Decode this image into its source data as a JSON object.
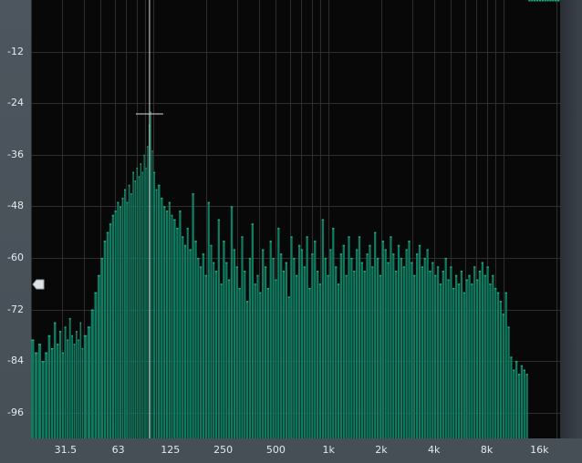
{
  "app": {
    "name": "spectrum-analyzer"
  },
  "y_axis": {
    "labels": [
      "-12",
      "-24",
      "-36",
      "-48",
      "-60",
      "-72",
      "-84",
      "-96"
    ],
    "values": [
      -12,
      -24,
      -36,
      -48,
      -60,
      -72,
      -84,
      -96
    ],
    "range": [
      -102,
      0
    ]
  },
  "x_axis": {
    "labels": [
      "31.5",
      "63",
      "125",
      "250",
      "500",
      "1k",
      "2k",
      "4k",
      "8k",
      "16k"
    ],
    "values": [
      31.5,
      63,
      125,
      250,
      500,
      1000,
      2000,
      4000,
      8000,
      16000
    ],
    "range": [
      20,
      21000
    ],
    "scale": "log"
  },
  "cursor": {
    "frequency": 95,
    "level": -26.5
  },
  "colors": {
    "bars": "#0f7b60",
    "bars_highlight": "#1fa882",
    "grid": "#2e2e2e",
    "background": "#080808",
    "cursor": "#d9d9d9"
  },
  "chart_data": {
    "type": "bar",
    "series_label": "",
    "x_scale": "log",
    "xlim": [
      20,
      21000
    ],
    "ylim": [
      -102,
      0
    ],
    "x": [
      20,
      21,
      22,
      23,
      24,
      25,
      26,
      27,
      28,
      29,
      30,
      31,
      32,
      33,
      34,
      35,
      36,
      37,
      38,
      39,
      40,
      42,
      44,
      46,
      48,
      50,
      52,
      54,
      56,
      58,
      60,
      62,
      64,
      66,
      68,
      70,
      72,
      74,
      76,
      78,
      80,
      82,
      84,
      86,
      88,
      90,
      92,
      94,
      96,
      98,
      100,
      103,
      106,
      110,
      114,
      118,
      122,
      126,
      130,
      135,
      140,
      145,
      150,
      155,
      160,
      166,
      172,
      178,
      184,
      190,
      197,
      204,
      211,
      218,
      225,
      233,
      241,
      249,
      258,
      267,
      276,
      286,
      296,
      306,
      317,
      328,
      339,
      351,
      363,
      376,
      389,
      402,
      416,
      431,
      446,
      461,
      477,
      494,
      511,
      529,
      547,
      566,
      586,
      606,
      627,
      649,
      672,
      695,
      719,
      744,
      770,
      797,
      825,
      854,
      884,
      915,
      947,
      980,
      1014,
      1049,
      1086,
      1124,
      1163,
      1204,
      1246,
      1290,
      1335,
      1382,
      1430,
      1480,
      1532,
      1585,
      1641,
      1698,
      1758,
      1819,
      1883,
      1949,
      2017,
      2088,
      2161,
      2237,
      2315,
      2396,
      2480,
      2567,
      2657,
      2750,
      2846,
      2946,
      3049,
      3156,
      3266,
      3381,
      3499,
      3622,
      3749,
      3880,
      4016,
      4157,
      4302,
      4453,
      4609,
      4770,
      4937,
      5110,
      5289,
      5474,
      5666,
      5864,
      6070,
      6282,
      6502,
      6730,
      6965,
      7209,
      7462,
      7723,
      7993,
      8273,
      8563,
      8863,
      9173,
      9494,
      9826,
      10170,
      10526,
      10895,
      11276,
      11671,
      12080,
      12502,
      12940,
      13393,
      13862,
      14347,
      14849,
      15369,
      15907,
      16463,
      17040,
      17636,
      18253,
      18892,
      19553,
      20238,
      20946
    ],
    "values": [
      -79,
      -82,
      -80,
      -84,
      -82,
      -78,
      -81,
      -75,
      -80,
      -77,
      -82,
      -76,
      -79,
      -74,
      -78,
      -80,
      -77,
      -79,
      -75,
      -81,
      -78,
      -76,
      -72,
      -68,
      -64,
      -60,
      -56,
      -54,
      -52,
      -50,
      -49,
      -47,
      -48,
      -46,
      -44,
      -47,
      -43,
      -45,
      -40,
      -42,
      -39,
      -41,
      -38,
      -40,
      -36,
      -39,
      -34,
      -29,
      -26,
      -35,
      -40,
      -44,
      -43,
      -46,
      -48,
      -49,
      -47,
      -50,
      -51,
      -53,
      -49,
      -55,
      -57,
      -53,
      -58,
      -45,
      -56,
      -60,
      -62,
      -59,
      -64,
      -47,
      -57,
      -61,
      -63,
      -51,
      -66,
      -56,
      -61,
      -65,
      -48,
      -58,
      -62,
      -67,
      -55,
      -63,
      -70,
      -60,
      -52,
      -66,
      -64,
      -68,
      -58,
      -62,
      -67,
      -56,
      -60,
      -65,
      -53,
      -59,
      -63,
      -61,
      -69,
      -55,
      -60,
      -64,
      -57,
      -58,
      -62,
      -55,
      -67,
      -59,
      -56,
      -63,
      -66,
      -51,
      -60,
      -64,
      -58,
      -53,
      -62,
      -66,
      -59,
      -57,
      -64,
      -55,
      -60,
      -63,
      -58,
      -55,
      -61,
      -63,
      -59,
      -57,
      -62,
      -54,
      -60,
      -64,
      -56,
      -58,
      -61,
      -55,
      -59,
      -63,
      -57,
      -60,
      -62,
      -58,
      -56,
      -61,
      -64,
      -59,
      -57,
      -62,
      -60,
      -58,
      -63,
      -61,
      -64,
      -62,
      -66,
      -63,
      -60,
      -65,
      -62,
      -67,
      -64,
      -66,
      -63,
      -68,
      -65,
      -64,
      -66,
      -62,
      -65,
      -63,
      -61,
      -64,
      -62,
      -66,
      -64,
      -67,
      -68,
      -70,
      -73,
      -68,
      -76,
      -83,
      -86,
      -84,
      -87,
      -85,
      -86,
      -87
    ]
  }
}
